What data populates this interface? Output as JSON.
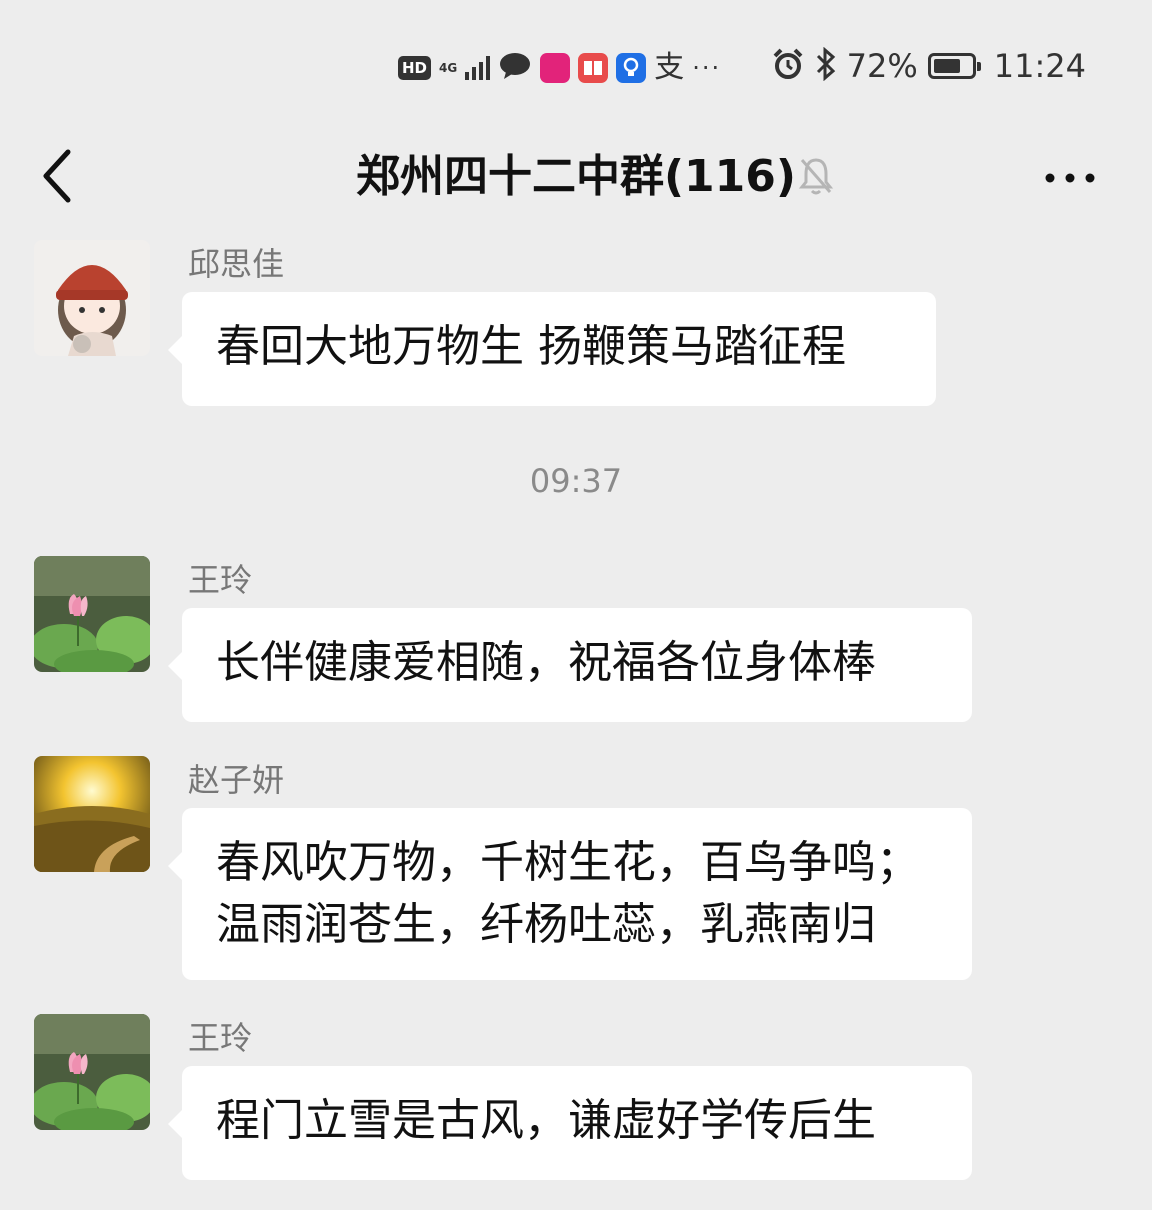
{
  "status_bar": {
    "hd": "HD",
    "network": "4G",
    "alipay_glyph": "支",
    "dots": "···",
    "battery_percent": "72%",
    "battery_level": 0.72,
    "time": "11:24",
    "icons": [
      "signal-icon",
      "chat-bubble-icon",
      "vipshop-icon",
      "book-app-icon",
      "bulb-app-icon",
      "alipay-icon",
      "alarm-icon",
      "bluetooth-icon",
      "battery-icon"
    ]
  },
  "header": {
    "title": "郑州四十二中群(116)",
    "back_icon": "chevron-left-icon",
    "mute_icon": "bell-off-icon",
    "more_icon": "more-dots-icon"
  },
  "messages": [
    {
      "sender": "邱思佳",
      "lines": [
        "春回大地万物生 扬鞭策马踏征程"
      ],
      "avatar": "cartoon-girl-avatar"
    },
    {
      "sender": "王玲",
      "lines": [
        "长伴健康爱相随，祝福各位身体棒"
      ],
      "avatar": "lotus-avatar"
    },
    {
      "sender": "赵子妍",
      "lines": [
        "春风吹万物，千树生花，百鸟争鸣；",
        "温雨润苍生，纤杨吐蕊，乳燕南归"
      ],
      "avatar": "sunset-field-avatar"
    },
    {
      "sender": "王玲",
      "lines": [
        "程门立雪是古风，谦虚好学传后生"
      ],
      "avatar": "lotus-avatar"
    }
  ],
  "timestamp": "09:37"
}
